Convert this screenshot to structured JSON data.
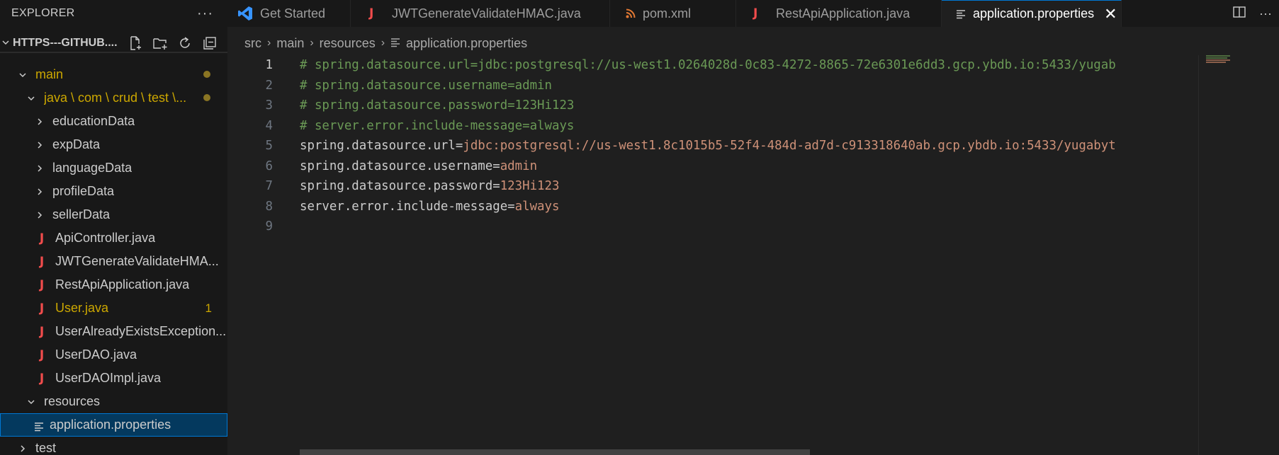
{
  "sidebar": {
    "title": "EXPLORER",
    "more": "···",
    "root_label": "HTTPS---GITHUB....",
    "tree": [
      {
        "label": "main",
        "indent": 0,
        "kind": "folder-open",
        "modified": true,
        "dot": true
      },
      {
        "label": "java \\ com \\ crud \\ test \\...",
        "indent": 1,
        "kind": "folder-open",
        "modified": true,
        "dot": true
      },
      {
        "label": "educationData",
        "indent": 2,
        "kind": "folder"
      },
      {
        "label": "expData",
        "indent": 2,
        "kind": "folder"
      },
      {
        "label": "languageData",
        "indent": 2,
        "kind": "folder"
      },
      {
        "label": "profileData",
        "indent": 2,
        "kind": "folder"
      },
      {
        "label": "sellerData",
        "indent": 2,
        "kind": "folder"
      },
      {
        "label": "ApiController.java",
        "indent": 2,
        "kind": "java"
      },
      {
        "label": "JWTGenerateValidateHMA...",
        "indent": 2,
        "kind": "java"
      },
      {
        "label": "RestApiApplication.java",
        "indent": 2,
        "kind": "java"
      },
      {
        "label": "User.java",
        "indent": 2,
        "kind": "java",
        "modified": true,
        "count": "1"
      },
      {
        "label": "UserAlreadyExistsException...",
        "indent": 2,
        "kind": "java"
      },
      {
        "label": "UserDAO.java",
        "indent": 2,
        "kind": "java"
      },
      {
        "label": "UserDAOImpl.java",
        "indent": 2,
        "kind": "java"
      },
      {
        "label": "resources",
        "indent": 1,
        "kind": "folder-open"
      },
      {
        "label": "application.properties",
        "indent": 2,
        "kind": "props",
        "selected": true
      },
      {
        "label": "test",
        "indent": 0,
        "kind": "folder"
      }
    ]
  },
  "tabs": [
    {
      "label": "Get Started",
      "icon": "vscode-icon"
    },
    {
      "label": "JWTGenerateValidateHMAC.java",
      "icon": "java-icon"
    },
    {
      "label": "pom.xml",
      "icon": "rss-icon"
    },
    {
      "label": "RestApiApplication.java",
      "icon": "java-icon"
    },
    {
      "label": "application.properties",
      "icon": "lines-icon",
      "active": true,
      "close": "✕"
    }
  ],
  "breadcrumb": [
    "src",
    "main",
    "resources",
    "application.properties"
  ],
  "editor": {
    "lines": [
      {
        "num": "1",
        "comment": "# spring.datasource.url=jdbc:postgresql://us-west1.0264028d-0c83-4272-8865-72e6301e6dd3.gcp.ybdb.io:5433/yugab",
        "current": true
      },
      {
        "num": "2",
        "comment": "# spring.datasource.username=admin"
      },
      {
        "num": "3",
        "comment": "# spring.datasource.password=123Hi123"
      },
      {
        "num": "4",
        "comment": "# server.error.include-message=always"
      },
      {
        "num": "5",
        "key": "spring.datasource.url=",
        "value": "jdbc:postgresql://us-west1.8c1015b5-52f4-484d-ad7d-c913318640ab.gcp.ybdb.io:5433/yugabyt"
      },
      {
        "num": "6",
        "key": "spring.datasource.username=",
        "value": "admin"
      },
      {
        "num": "7",
        "key": "spring.datasource.password=",
        "value": "123Hi123"
      },
      {
        "num": "8",
        "key": "server.error.include-message=",
        "value": "always"
      },
      {
        "num": "9"
      }
    ]
  },
  "colors": {
    "accent": "#0078d4",
    "selection": "#04395e",
    "modified": "#cca700",
    "comment": "#6a9955",
    "string": "#ce9178",
    "java": "#f14c4c"
  }
}
